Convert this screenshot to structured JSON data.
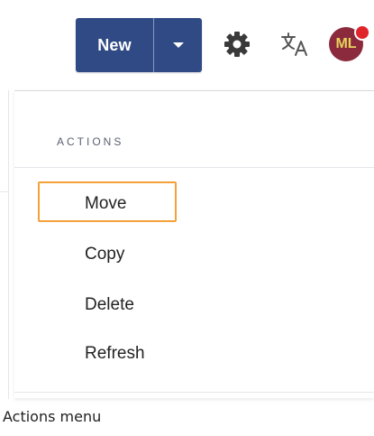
{
  "toolbar": {
    "new_label": "New",
    "settings_icon": "gear-icon",
    "language_icon": "translate-icon",
    "avatar_initials": "ML"
  },
  "menu": {
    "heading": "ACTIONS",
    "items": [
      {
        "label": "Move",
        "highlighted": true
      },
      {
        "label": "Copy"
      },
      {
        "label": "Delete"
      },
      {
        "label": "Refresh"
      }
    ]
  },
  "caption": "Actions menu",
  "colors": {
    "primary": "#2f4a85",
    "highlight": "#f4a13a",
    "notification": "#e0242b",
    "avatar_bg": "#8b2a3d"
  }
}
